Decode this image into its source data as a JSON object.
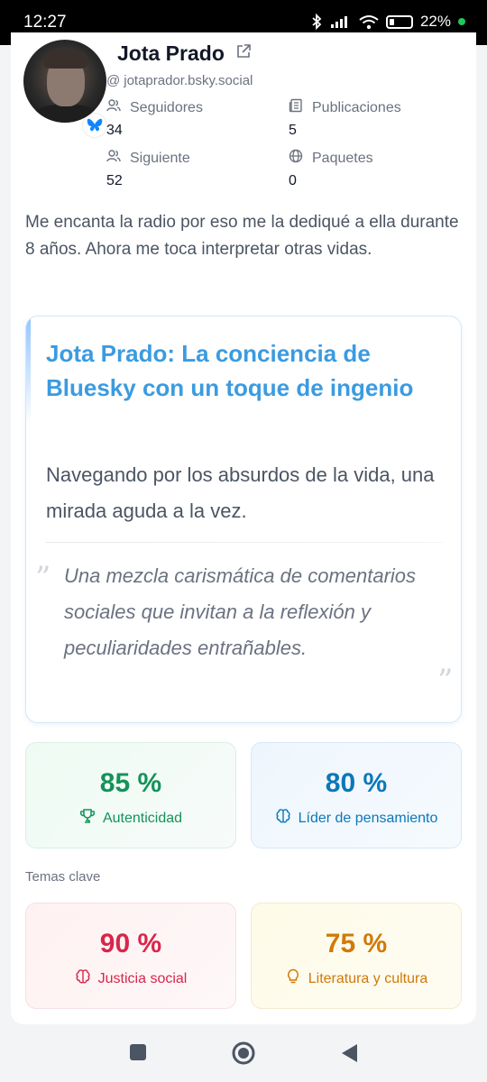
{
  "status_bar": {
    "time": "12:27",
    "battery": "22%",
    "battery_level": 0.22
  },
  "profile": {
    "name": "Jota Prado",
    "handle": "jotaprador.bsky.social",
    "handle_prefix": "@",
    "stats": [
      {
        "label": "Seguidores",
        "value": "34",
        "icon": "users-icon"
      },
      {
        "label": "Publicaciones",
        "value": "5",
        "icon": "newspaper-icon"
      },
      {
        "label": "Siguiente",
        "value": "52",
        "icon": "users-icon"
      },
      {
        "label": "Paquetes",
        "value": "0",
        "icon": "globe-icon"
      }
    ],
    "bio": "Me encanta la radio por eso me la dediqué a ella durante 8 años. Ahora me toca interpretar otras vidas."
  },
  "summary": {
    "title": "Jota Prado: La conciencia de Bluesky con un toque de ingenio",
    "subtitle": "Navegando por los absurdos de la vida, una mirada aguda a la vez.",
    "quote": "Una mezcla carismática de comentarios sociales que invitan a la reflexión y peculiaridades entrañables.",
    "quote_open": "”",
    "quote_close": "”"
  },
  "metrics": [
    {
      "value": "85 %",
      "label": "Autenticidad",
      "icon": "trophy-icon",
      "color": "#15925a"
    },
    {
      "value": "80 %",
      "label": "Líder de pensamiento",
      "icon": "brain-icon",
      "color": "#0b78b8"
    }
  ],
  "topics": {
    "heading": "Temas clave",
    "items": [
      {
        "value": "90 %",
        "label": "Justicia social",
        "icon": "brain-icon",
        "color": "#d8264b"
      },
      {
        "value": "75 %",
        "label": "Literatura y cultura",
        "icon": "lightbulb-icon",
        "color": "#d07a0a"
      }
    ]
  },
  "colors": {
    "accent": "#3b9be0",
    "bluesky": "#1185fe"
  }
}
